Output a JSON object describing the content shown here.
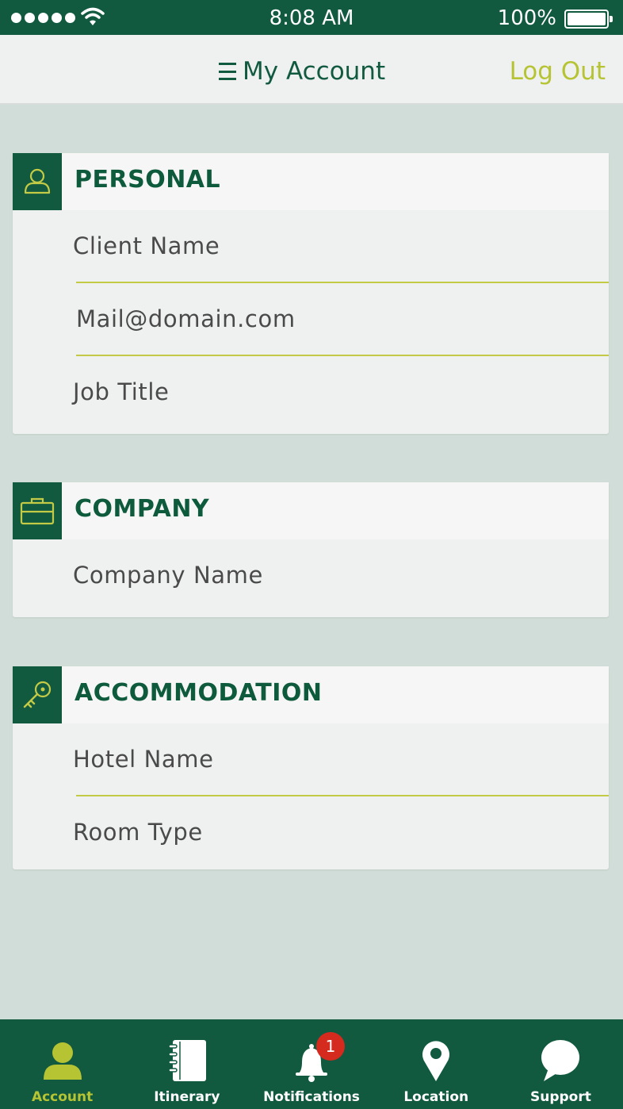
{
  "status_bar": {
    "time": "8:08 AM",
    "battery": "100%"
  },
  "nav": {
    "title": "My Account",
    "logout_label": "Log Out"
  },
  "sections": [
    {
      "title": "PERSONAL",
      "icon": "person-icon",
      "fields": [
        "Client Name",
        "Mail@domain.com",
        "Job Title"
      ]
    },
    {
      "title": "COMPANY",
      "icon": "briefcase-icon",
      "fields": [
        "Company Name"
      ]
    },
    {
      "title": "ACCOMMODATION",
      "icon": "key-icon",
      "fields": [
        "Hotel Name",
        "Room Type"
      ]
    }
  ],
  "tabs": [
    {
      "label": "Account",
      "icon": "account-icon",
      "active": true
    },
    {
      "label": "Itinerary",
      "icon": "notebook-icon",
      "active": false
    },
    {
      "label": "Notifications",
      "icon": "bell-icon",
      "active": false,
      "badge": "1"
    },
    {
      "label": "Location",
      "icon": "location-pin-icon",
      "active": false
    },
    {
      "label": "Support",
      "icon": "chat-bubble-icon",
      "active": false
    }
  ],
  "colors": {
    "primary": "#115a40",
    "accent": "#b6c332",
    "background": "#d1ddd8",
    "badge": "#d52a1e"
  }
}
